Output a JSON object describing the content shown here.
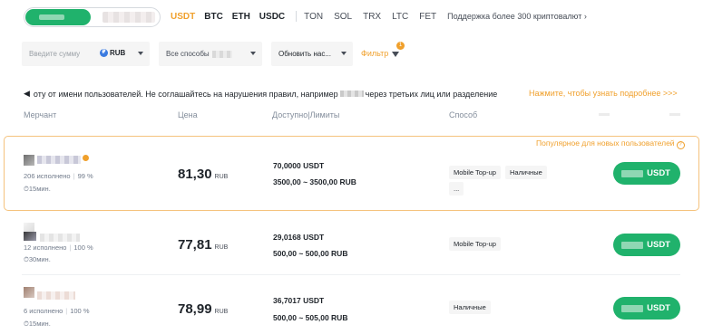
{
  "mode_toggle": {
    "active": "",
    "inactive": ""
  },
  "coins": [
    "USDT",
    "BTC",
    "ETH",
    "USDC"
  ],
  "more_coins": [
    "TON",
    "SOL",
    "TRX",
    "LTC",
    "FET"
  ],
  "support_link": "Поддержка более 300 криптовалют",
  "filters": {
    "amount_placeholder": "Введите сумму",
    "currency": "RUB",
    "methods_label": "Все способы",
    "refresh_label": "Обновить нас...",
    "filter_label": "Фильтр",
    "filter_count": "1"
  },
  "notice": {
    "text_part1": "оту от имени пользователей. Не соглашайтесь на нарушения правил, например",
    "text_part2": "через третьих лиц или разделение",
    "more_link": "Нажмите, чтобы узнать подробнее >>>"
  },
  "columns": {
    "merchant": "Мерчант",
    "price": "Цена",
    "available": "Доступно|Лимиты",
    "method": "Способ"
  },
  "ads": [
    {
      "highlight": true,
      "badge": "Популярное для новых пользователей",
      "stats": {
        "orders": "206 исполнено",
        "rate": "99 %"
      },
      "time": "15мин.",
      "price": "81,30",
      "price_unit": "RUB",
      "available": "70,0000 USDT",
      "limits": "3500,00 ~ 3500,00 RUB",
      "methods": [
        "Mobile Top-up",
        "Наличные",
        "..."
      ],
      "buy_label": "USDT"
    },
    {
      "highlight": false,
      "stats": {
        "orders": "12 исполнено",
        "rate": "100 %"
      },
      "time": "30мин.",
      "price": "77,81",
      "price_unit": "RUB",
      "available": "29,0168 USDT",
      "limits": "500,00 ~ 500,00 RUB",
      "methods": [
        "Mobile Top-up"
      ],
      "buy_label": "USDT"
    },
    {
      "highlight": false,
      "stats": {
        "orders": "6 исполнено",
        "rate": "100 %"
      },
      "time": "15мин.",
      "price": "78,99",
      "price_unit": "RUB",
      "available": "36,7017 USDT",
      "limits": "500,00 ~ 505,00 RUB",
      "methods": [
        "Наличные"
      ],
      "buy_label": "USDT"
    }
  ],
  "colors": {
    "accent": "#f0a02c",
    "buy_green": "#20b26c",
    "highlight_border": "#f5c27d",
    "text": "#1e2329",
    "muted": "#707a8a"
  }
}
